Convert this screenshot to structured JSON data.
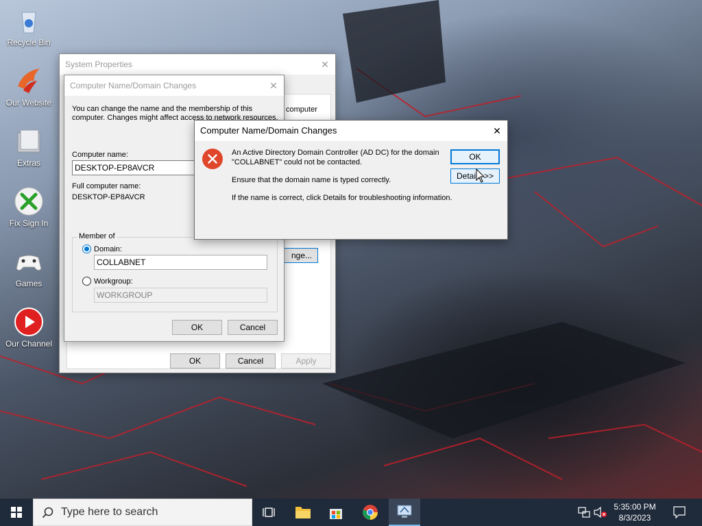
{
  "desktop": {
    "icons": [
      {
        "label": "Recycle Bin",
        "icon": "recycle-bin-icon"
      },
      {
        "label": "Our Website",
        "icon": "phoenix-icon"
      },
      {
        "label": "Extras",
        "icon": "folder-icon"
      },
      {
        "label": "Fix Sign In",
        "icon": "xbox-icon"
      },
      {
        "label": "Games",
        "icon": "gamepad-icon"
      },
      {
        "label": "Our Channel",
        "icon": "youtube-icon"
      }
    ]
  },
  "system_properties": {
    "title": "System Properties",
    "partial_text": "computer",
    "change_button_partial": "nge...",
    "ok": "OK",
    "cancel": "Cancel",
    "apply": "Apply"
  },
  "name_changes": {
    "title": "Computer Name/Domain Changes",
    "intro": [
      "You can change the name and the membership of this",
      "computer. Changes might affect access to network resources."
    ],
    "computer_name_label": "Computer name:",
    "computer_name_value": "DESKTOP-EP8AVCR",
    "full_name_label": "Full computer name:",
    "full_name_value": "DESKTOP-EP8AVCR",
    "member_of_label": "Member of",
    "domain_label": "Domain:",
    "domain_value": "COLLABNET",
    "workgroup_label": "Workgroup:",
    "workgroup_value": "WORKGROUP",
    "ok": "OK",
    "cancel": "Cancel"
  },
  "error_dialog": {
    "title": "Computer Name/Domain Changes",
    "message_line1": "An Active Directory Domain Controller (AD DC) for the domain",
    "message_line2": "\"COLLABNET\" could not be contacted.",
    "message_line3": "Ensure that the domain name is typed correctly.",
    "message_line4": "If the name is correct, click Details for troubleshooting information.",
    "ok": "OK",
    "details": "Details >>"
  },
  "taskbar": {
    "search_placeholder": "Type here to search",
    "time": "5:35:00 PM",
    "date": "8/3/2023"
  },
  "colors": {
    "accent": "#0078d7",
    "error_red": "#e0462a",
    "taskbar": "#1f2a3a"
  }
}
